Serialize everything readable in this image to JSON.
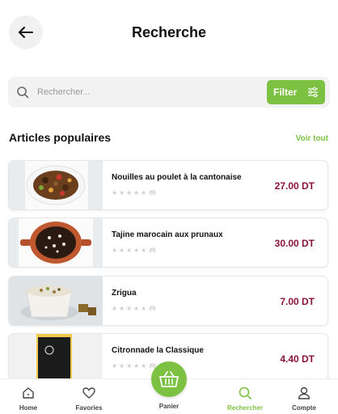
{
  "header": {
    "title": "Recherche",
    "back_icon": "arrow-left-icon"
  },
  "search": {
    "placeholder": "Rechercher...",
    "value": "",
    "filter_label": "Filter",
    "accent_color": "#7cc142"
  },
  "section": {
    "title": "Articles populaires",
    "see_all_label": "Voir tout"
  },
  "products": [
    {
      "name": "Nouilles au poulet à la cantonaise",
      "price": "27.00 DT",
      "rating_count": "(0)",
      "stars": 0,
      "image": "noodles-dish-image"
    },
    {
      "name": "Tajine marocain aux prunaux",
      "price": "30.00 DT",
      "rating_count": "(0)",
      "stars": 0,
      "image": "tajine-dish-image"
    },
    {
      "name": "Zrigua",
      "price": "7.00 DT",
      "rating_count": "(0)",
      "stars": 0,
      "image": "zrigua-dessert-image"
    },
    {
      "name": "Citronnade la Classique",
      "price": "4.40 DT",
      "rating_count": "(0)",
      "stars": 0,
      "image": "lemonade-bottle-image"
    }
  ],
  "price_color": "#8a1538",
  "bottom_nav": {
    "items": [
      {
        "label": "Home",
        "icon": "home-icon",
        "active": false
      },
      {
        "label": "Favories",
        "icon": "heart-icon",
        "active": false
      },
      {
        "label": "Panier",
        "icon": "basket-icon",
        "active": false
      },
      {
        "label": "Rechercher",
        "icon": "search-icon",
        "active": true
      },
      {
        "label": "Compte",
        "icon": "user-icon",
        "active": false
      }
    ]
  }
}
